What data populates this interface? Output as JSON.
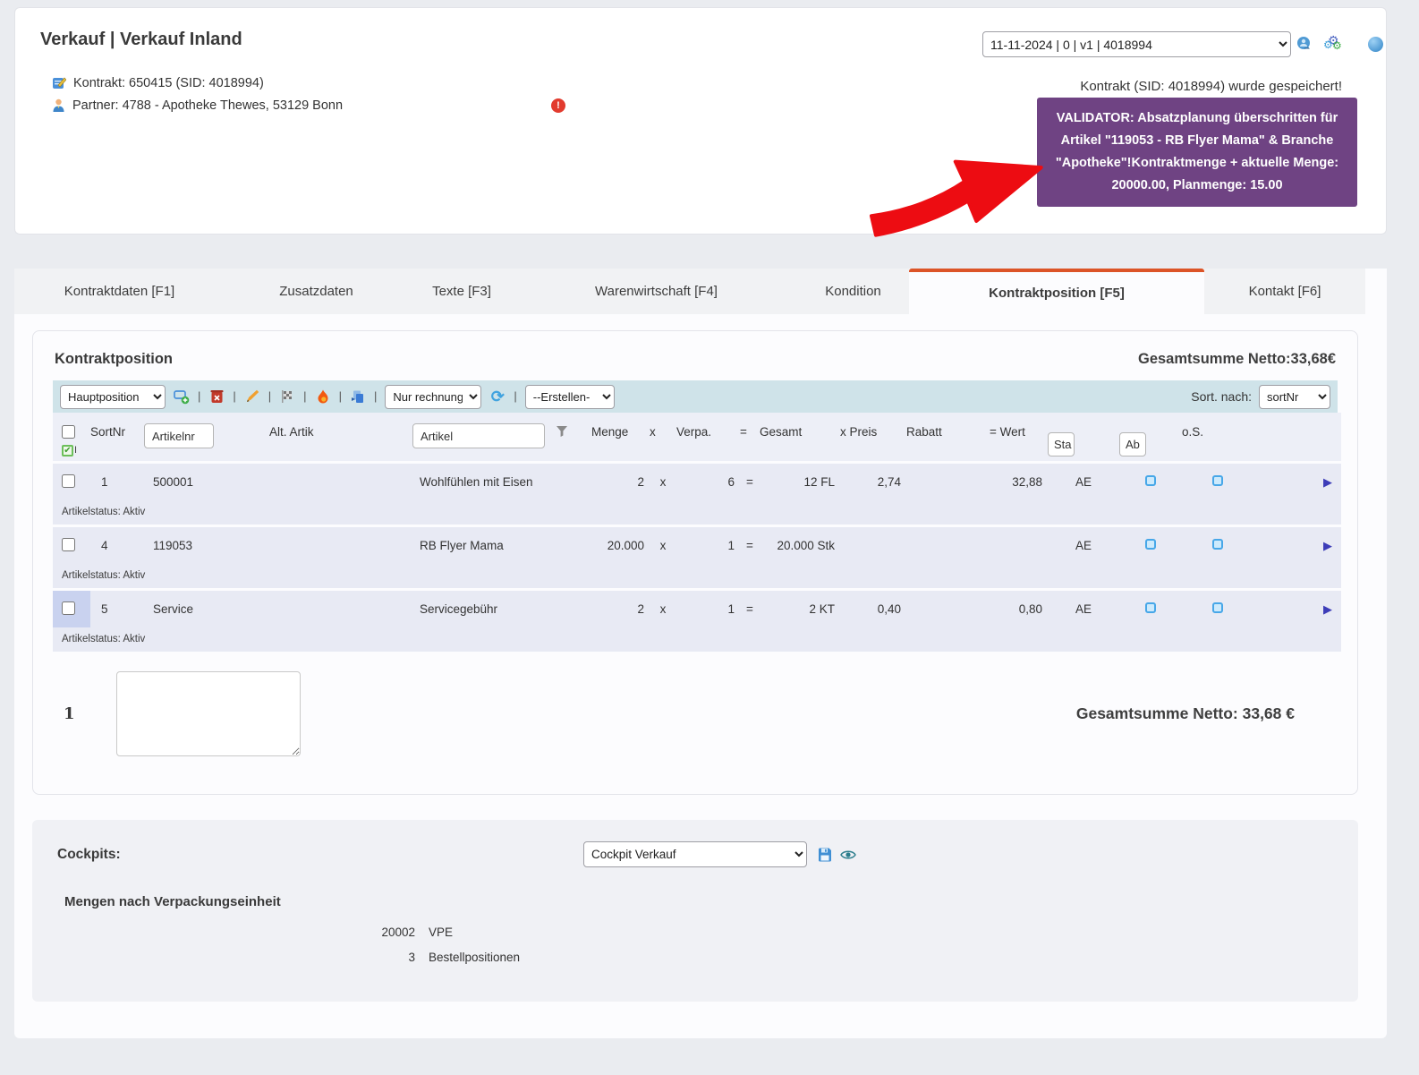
{
  "page": {
    "title": "Verkauf | Verkauf Inland"
  },
  "header": {
    "kontrakt_label": "Kontrakt: 650415 (SID: 4018994)",
    "partner_label": "Partner: 4788 - Apotheke Thewes, 53129 Bonn",
    "error_badge": "!",
    "version_select_value": "11-11-2024 | 0 | v1 | 4018994",
    "saved_message": "Kontrakt (SID: 4018994) wurde gespeichert!",
    "validator_message": "VALIDATOR: Absatzplanung überschritten für Artikel \"119053 - RB Flyer Mama\" & Branche \"Apotheke\"!Kontraktmenge + aktuelle Menge: 20000.00, Planmenge: 15.00"
  },
  "tabs": [
    {
      "label": "Kontraktdaten [F1]",
      "active": false
    },
    {
      "label": "Zusatzdaten",
      "active": false
    },
    {
      "label": "Texte [F3]",
      "active": false
    },
    {
      "label": "Warenwirtschaft [F4]",
      "active": false
    },
    {
      "label": "Kondition",
      "active": false
    },
    {
      "label": "Kontraktposition [F5]",
      "active": true
    },
    {
      "label": "Kontakt [F6]",
      "active": false
    }
  ],
  "position_panel": {
    "title": "Kontraktposition",
    "total_label": "Gesamtsumme Netto:33,68€",
    "toolbar": {
      "position_type_value": "Hauptposition",
      "filter_select_value": "Nur rechnung",
      "create_select_value": "--Erstellen-",
      "sort_label": "Sort. nach:",
      "sort_select_value": "sortNr"
    },
    "table": {
      "headers": {
        "sortnr": "SortNr",
        "alt_artikel": "Alt. Artik",
        "menge": "Menge",
        "mult": "x",
        "verpa": "Verpa.",
        "eq": "=",
        "gesamt": "Gesamt",
        "preis": "x Preis",
        "rabatt": "Rabatt",
        "wert": "= Wert",
        "sta": "Sta",
        "ab": "Ab",
        "os": "o.S."
      },
      "artikelnr_placeholder": "Artikelnr",
      "artikel_placeholder": "Artikel",
      "rows": [
        {
          "sortnr": "1",
          "artikelnr": "500001",
          "artikel": "Wohlfühlen mit Eisen",
          "menge": "2",
          "verpa": "6",
          "gesamt": "12 FL",
          "preis": "2,74",
          "rabatt": "",
          "wert": "32,88",
          "status": "AE",
          "artikelstatus": "Artikelstatus: Aktiv",
          "highlighted": false
        },
        {
          "sortnr": "4",
          "artikelnr": "119053",
          "artikel": "RB Flyer Mama",
          "menge": "20.000",
          "verpa": "1",
          "gesamt": "20.000 Stk",
          "preis": "",
          "rabatt": "",
          "wert": "",
          "status": "AE",
          "artikelstatus": "Artikelstatus: Aktiv",
          "highlighted": false
        },
        {
          "sortnr": "5",
          "artikelnr": "Service",
          "artikel": "Servicegebühr",
          "menge": "2",
          "verpa": "1",
          "gesamt": "2 KT",
          "preis": "0,40",
          "rabatt": "",
          "wert": "0,80",
          "status": "AE",
          "artikelstatus": "Artikelstatus: Aktiv",
          "highlighted": true
        }
      ]
    },
    "footer": {
      "row_number": "1",
      "total_label": "Gesamtsumme Netto: 33,68 €"
    }
  },
  "cockpits": {
    "title": "Cockpits:",
    "select_value": "Cockpit Verkauf",
    "section_title": "Mengen nach Verpackungseinheit",
    "stats": [
      {
        "value": "20002",
        "label": "VPE"
      },
      {
        "value": "3",
        "label": "Bestellpositionen"
      }
    ]
  },
  "colors": {
    "accent_tab": "#dc5427",
    "validator_purple": "#6f4383",
    "toolbar_teal": "#cfe3e9",
    "row_lavender": "#e8eaf4",
    "arrow_red": "#ed0c12"
  }
}
